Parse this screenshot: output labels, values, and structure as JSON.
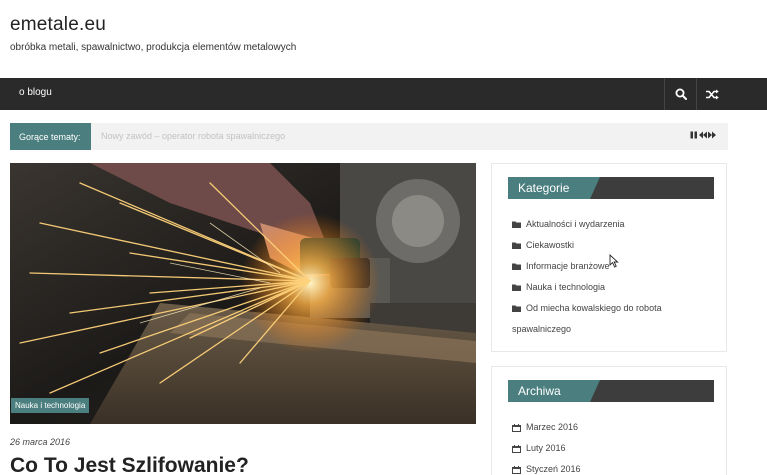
{
  "site": {
    "title": "emetale.eu",
    "description": "obróbka metali, spawalnictwo, produkcja elementów metalowych"
  },
  "nav": {
    "item": "o blogu",
    "search_icon": "search-icon",
    "random_icon": "shuffle-icon"
  },
  "ticker": {
    "label": "Gorące tematy:",
    "text": "Nowy zawód – operator robota spawalniczego"
  },
  "post": {
    "category": "Nauka i technologia",
    "date": "26 marca 2016",
    "title": "Co To Jest Szlifowanie?"
  },
  "categories_widget": {
    "title": "Kategorie",
    "items": [
      "Aktualności i wydarzenia",
      "Ciekawostki",
      "Informacje branżowe",
      "Nauka i technologia",
      "Od miecha kowalskiego do robota",
      "spawalniczego"
    ]
  },
  "archive_widget": {
    "title": "Archiwa",
    "items": [
      "Marzec 2016",
      "Luty 2016",
      "Styczeń 2016"
    ]
  },
  "colors": {
    "accent": "#4b7e7e",
    "nav_bg": "#2a2a2a",
    "widget_bar": "#3d3d3d"
  }
}
